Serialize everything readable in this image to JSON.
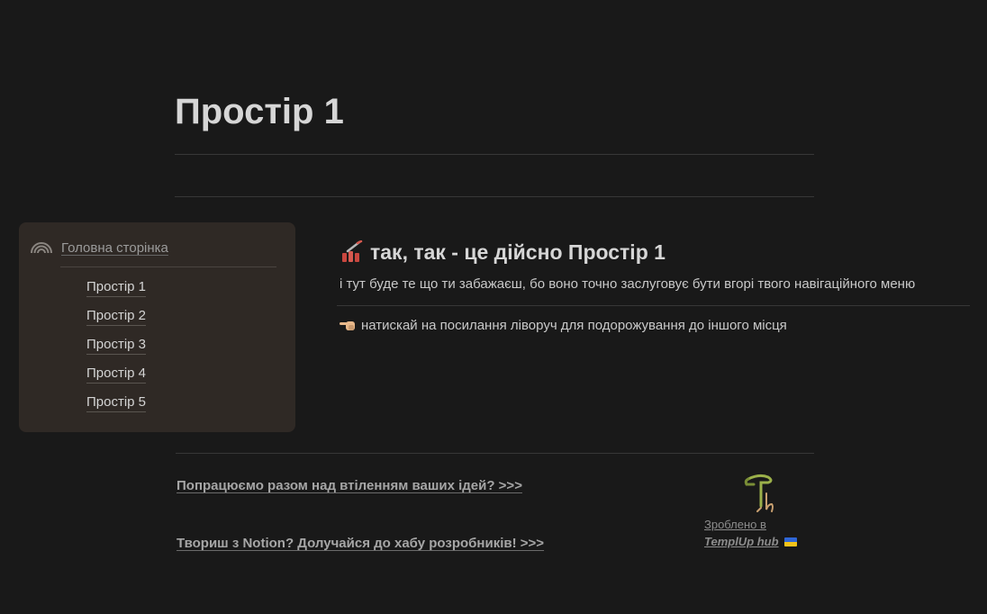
{
  "page": {
    "title": "Простір 1"
  },
  "sidebar": {
    "home_label": "Головна сторінка",
    "home_icon": "rainbow-icon",
    "items": [
      {
        "label": "Простір 1"
      },
      {
        "label": "Простір 2"
      },
      {
        "label": "Простір 3"
      },
      {
        "label": "Простір 4"
      },
      {
        "label": "Простір 5"
      }
    ]
  },
  "content": {
    "heading_icon": "lipstick-icon",
    "heading": "так, так - це дійсно Простір 1",
    "description": "і тут буде те що ти забажаєш, бо воно точно заслуговує бути вгорі твого навігаційного меню",
    "hint_icon": "hand-pointing-left-icon",
    "hint": "натискай на посилання ліворуч для подорожування до іншого місця"
  },
  "footer": {
    "link1": "Попрацюємо разом над втіленням ваших ідей? >>>",
    "link2": "Твориш з Notion? Долучайся до хабу розробників! >>>",
    "made_in": "Зроблено в",
    "brand": "TemplUp hub",
    "logo_icon": "templup-logo-icon",
    "flag_icon": "ukraine-flag-icon"
  },
  "colors": {
    "background": "#191919",
    "card": "#2f2925",
    "divider": "#373737"
  }
}
